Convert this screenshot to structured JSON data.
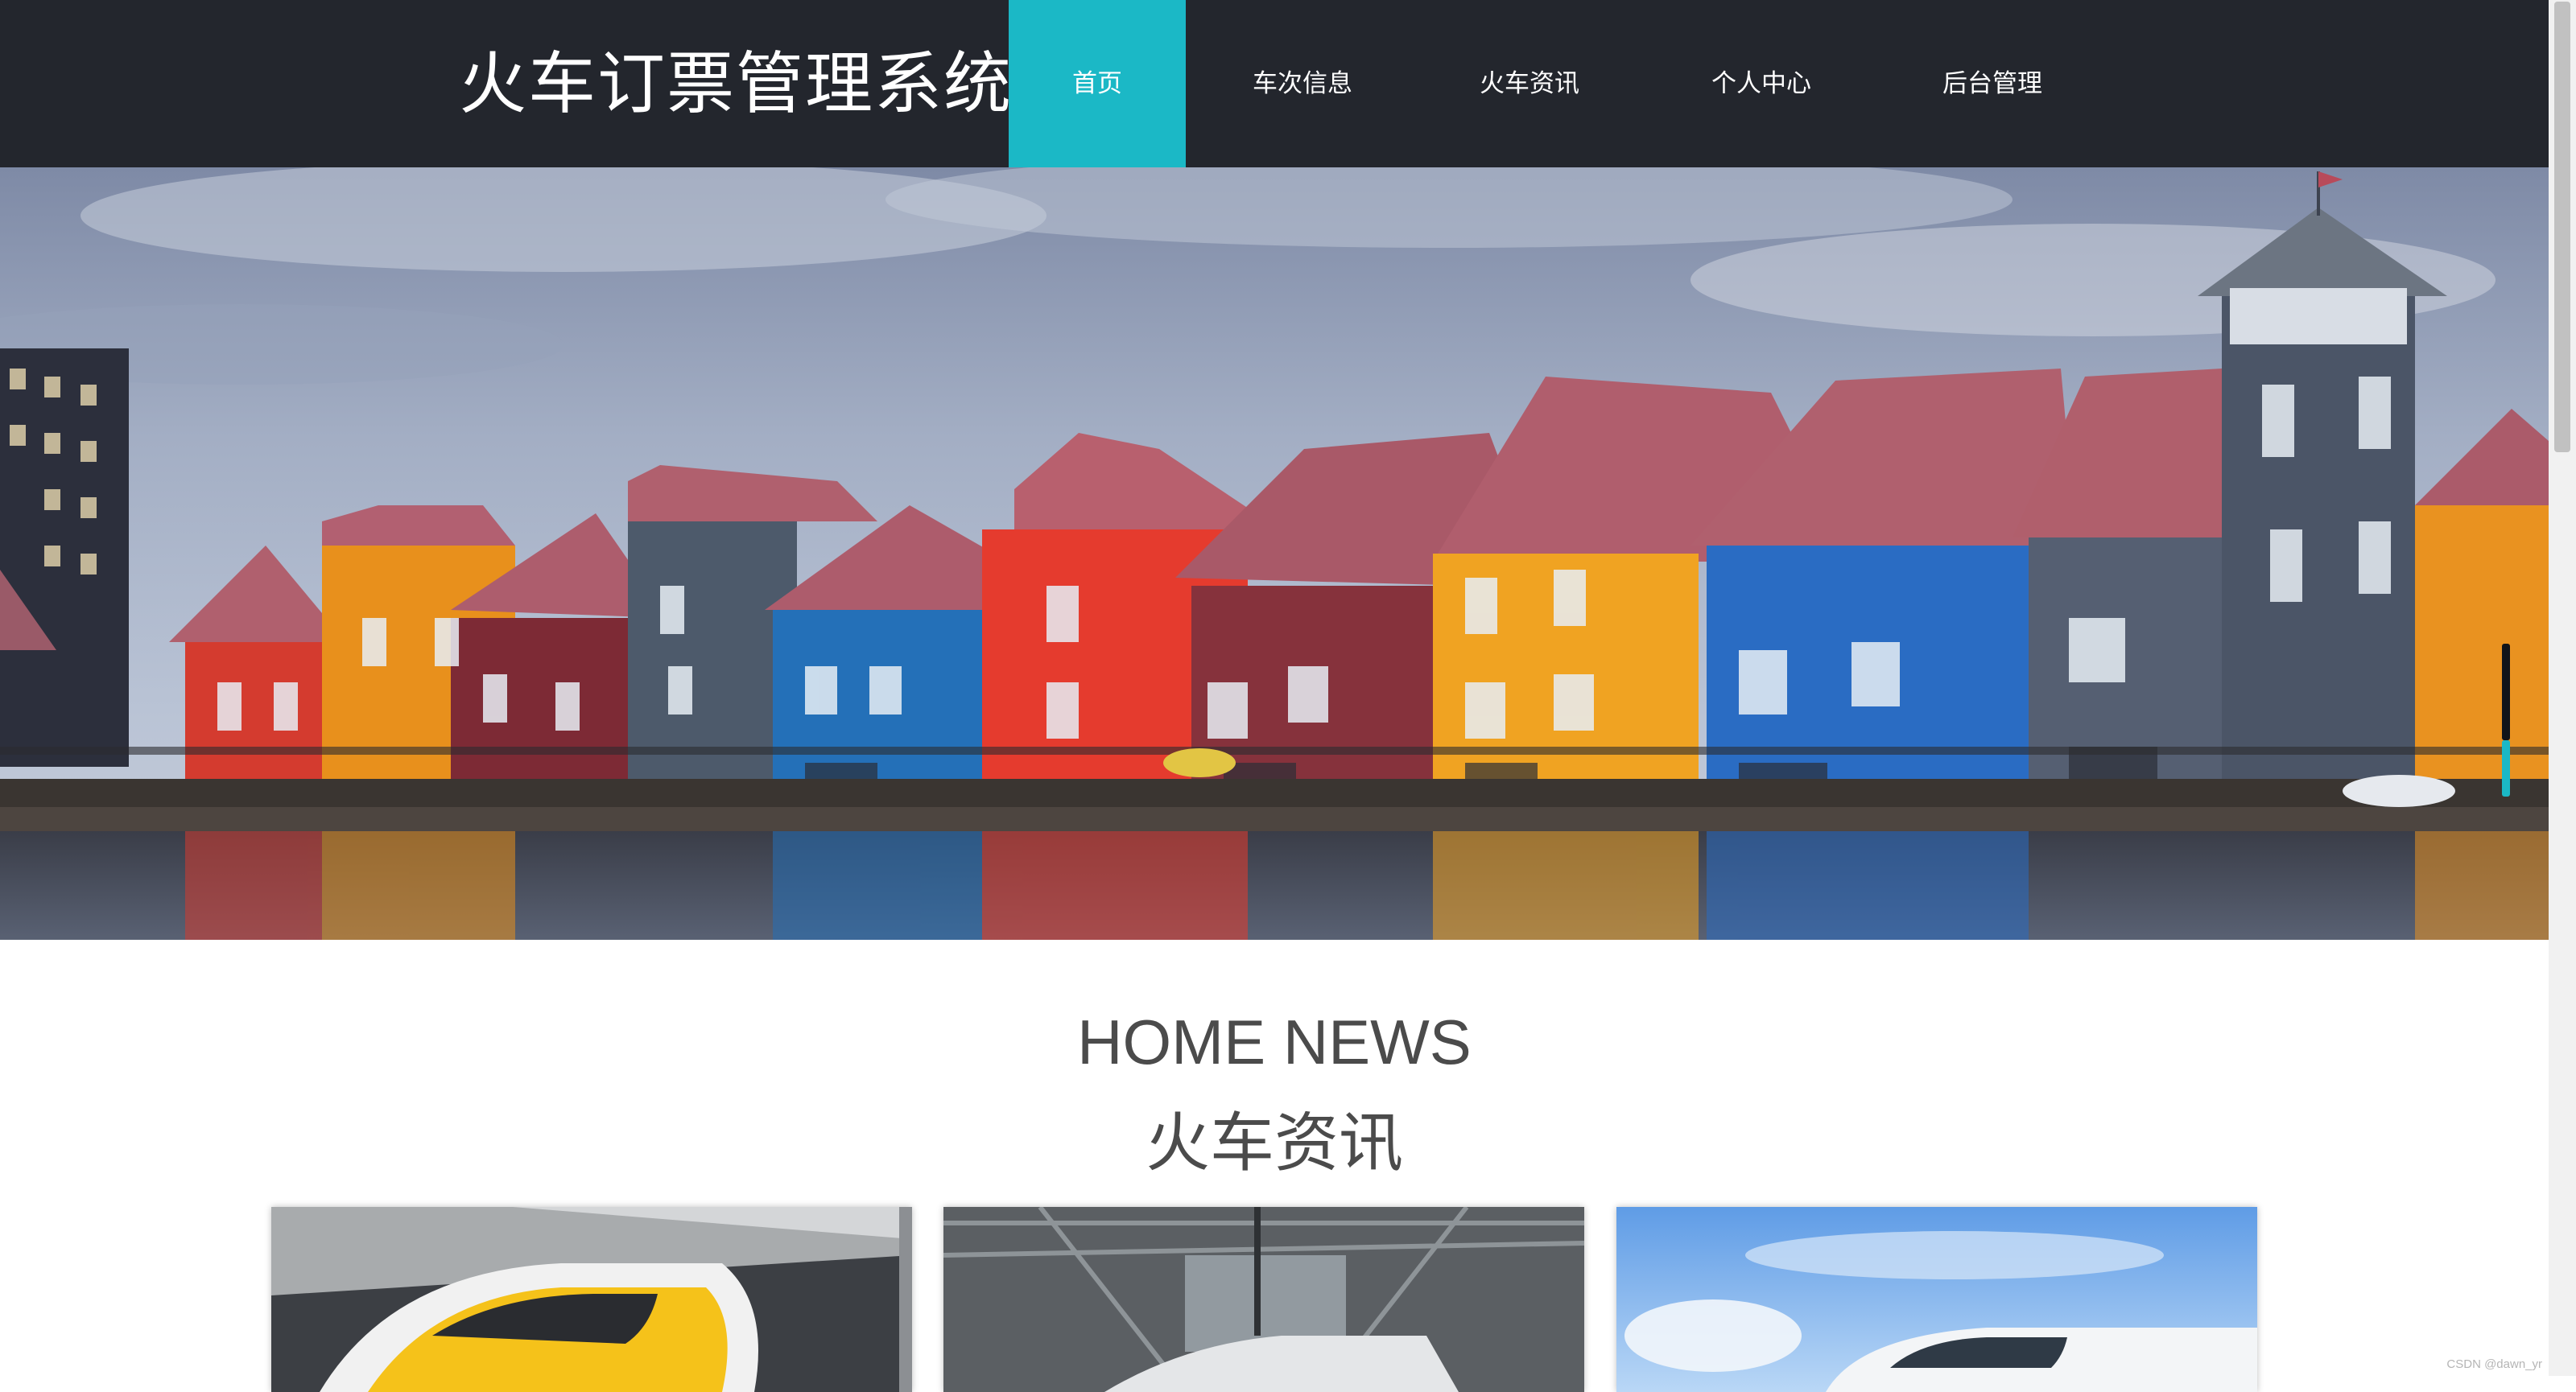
{
  "header": {
    "title": "火车订票管理系统",
    "nav": [
      {
        "label": "首页",
        "active": true
      },
      {
        "label": "车次信息",
        "active": false
      },
      {
        "label": "火车资讯",
        "active": false
      },
      {
        "label": "个人中心",
        "active": false
      },
      {
        "label": "后台管理",
        "active": false
      }
    ]
  },
  "banner": {
    "image": "colorful canal houses reflected in water",
    "active_slide_indicator": 1
  },
  "news": {
    "heading_en": "HOME NEWS",
    "heading_zh": "火车资讯",
    "cards": [
      {
        "image": "yellow high-speed train nose"
      },
      {
        "image": "train station platform interior"
      },
      {
        "image": "white bullet train under blue sky"
      }
    ]
  },
  "watermark": "CSDN @dawn_yr",
  "colors": {
    "nav_background": "#23262d",
    "accent": "#1bb8c6",
    "heading_text": "#4b4b4b"
  }
}
